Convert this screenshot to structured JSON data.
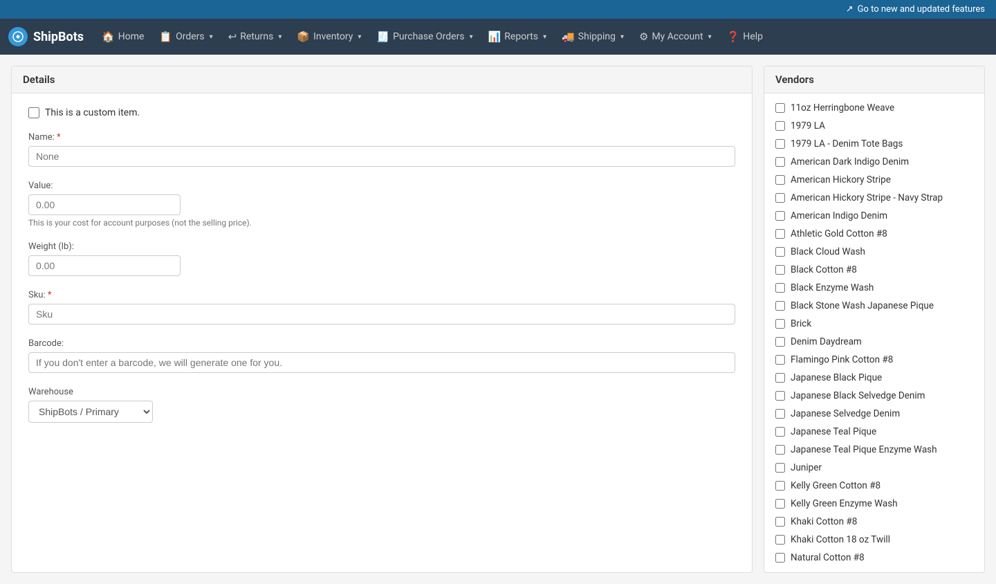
{
  "topBanner": {
    "linkText": "Go to new and updated features",
    "linkIcon": "↗"
  },
  "navbar": {
    "brand": "ShipBots",
    "items": [
      {
        "id": "home",
        "label": "Home",
        "icon": "🏠",
        "hasCaret": false
      },
      {
        "id": "orders",
        "label": "Orders",
        "icon": "📋",
        "hasCaret": true
      },
      {
        "id": "returns",
        "label": "Returns",
        "icon": "↩",
        "hasCaret": true
      },
      {
        "id": "inventory",
        "label": "Inventory",
        "icon": "📦",
        "hasCaret": true
      },
      {
        "id": "purchase-orders",
        "label": "Purchase Orders",
        "icon": "🧾",
        "hasCaret": true
      },
      {
        "id": "reports",
        "label": "Reports",
        "icon": "📊",
        "hasCaret": true
      },
      {
        "id": "shipping",
        "label": "Shipping",
        "icon": "🚚",
        "hasCaret": true
      },
      {
        "id": "my-account",
        "label": "My Account",
        "icon": "⚙",
        "hasCaret": true
      },
      {
        "id": "help",
        "label": "Help",
        "icon": "❓",
        "hasCaret": false
      }
    ]
  },
  "detailsPanel": {
    "title": "Details",
    "customItemLabel": "This is a custom item.",
    "nameField": {
      "label": "Name:",
      "placeholder": "None",
      "required": true
    },
    "valueField": {
      "label": "Value:",
      "value": "0.00",
      "hint": "This is your cost for account purposes (not the selling price)."
    },
    "weightField": {
      "label": "Weight (lb):",
      "value": "0.00"
    },
    "skuField": {
      "label": "Sku:",
      "placeholder": "Sku",
      "required": true
    },
    "barcodeField": {
      "label": "Barcode:",
      "placeholder": "If you don't enter a barcode, we will generate one for you."
    },
    "warehouseField": {
      "label": "Warehouse",
      "options": [
        "ShipBots / Primary"
      ],
      "selectedValue": "ShipBots / Primary"
    }
  },
  "vendorsPanel": {
    "title": "Vendors",
    "items": [
      {
        "id": "v1",
        "label": "11oz Herringbone Weave",
        "checked": false
      },
      {
        "id": "v2",
        "label": "1979 LA",
        "checked": false
      },
      {
        "id": "v3",
        "label": "1979 LA - Denim Tote Bags",
        "checked": false
      },
      {
        "id": "v4",
        "label": "American Dark Indigo Denim",
        "checked": false
      },
      {
        "id": "v5",
        "label": "American Hickory Stripe",
        "checked": false
      },
      {
        "id": "v6",
        "label": "American Hickory Stripe - Navy Strap",
        "checked": false
      },
      {
        "id": "v7",
        "label": "American Indigo Denim",
        "checked": false
      },
      {
        "id": "v8",
        "label": "Athletic Gold Cotton #8",
        "checked": false
      },
      {
        "id": "v9",
        "label": "Black Cloud Wash",
        "checked": false
      },
      {
        "id": "v10",
        "label": "Black Cotton #8",
        "checked": false
      },
      {
        "id": "v11",
        "label": "Black Enzyme Wash",
        "checked": false
      },
      {
        "id": "v12",
        "label": "Black Stone Wash Japanese Pique",
        "checked": false
      },
      {
        "id": "v13",
        "label": "Brick",
        "checked": false
      },
      {
        "id": "v14",
        "label": "Denim Daydream",
        "checked": false
      },
      {
        "id": "v15",
        "label": "Flamingo Pink Cotton #8",
        "checked": false
      },
      {
        "id": "v16",
        "label": "Japanese Black Pique",
        "checked": false
      },
      {
        "id": "v17",
        "label": "Japanese Black Selvedge Denim",
        "checked": false
      },
      {
        "id": "v18",
        "label": "Japanese Selvedge Denim",
        "checked": false
      },
      {
        "id": "v19",
        "label": "Japanese Teal Pique",
        "checked": false
      },
      {
        "id": "v20",
        "label": "Japanese Teal Pique Enzyme Wash",
        "checked": false
      },
      {
        "id": "v21",
        "label": "Juniper",
        "checked": false
      },
      {
        "id": "v22",
        "label": "Kelly Green Cotton #8",
        "checked": false
      },
      {
        "id": "v23",
        "label": "Kelly Green Enzyme Wash",
        "checked": false
      },
      {
        "id": "v24",
        "label": "Khaki Cotton #8",
        "checked": false
      },
      {
        "id": "v25",
        "label": "Khaki Cotton 18 oz Twill",
        "checked": false
      },
      {
        "id": "v26",
        "label": "Natural Cotton #8",
        "checked": false
      }
    ]
  }
}
